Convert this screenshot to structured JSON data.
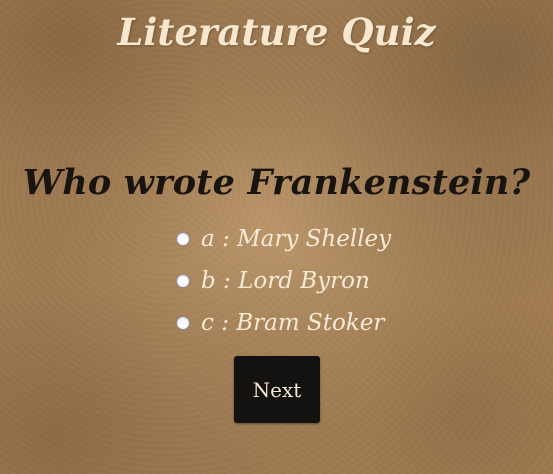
{
  "header": {
    "title": "Literature Quiz"
  },
  "quiz": {
    "question": "Who wrote Frankenstein?",
    "answers": [
      {
        "letter": "a",
        "separator": " : ",
        "text": "Mary Shelley"
      },
      {
        "letter": "b",
        "separator": " : ",
        "text": "Lord Byron"
      },
      {
        "letter": "c",
        "separator": " : ",
        "text": "Bram Stoker"
      }
    ],
    "next_label": "Next"
  },
  "colors": {
    "title": "#f7e7cf",
    "question": "#1a1410",
    "answer_text": "#f7ead6",
    "button_bg": "#141210",
    "button_text": "#f4e6cf",
    "background": "#b08a5f"
  }
}
